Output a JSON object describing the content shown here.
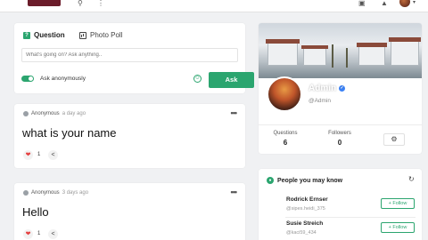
{
  "topbar": {
    "icons": [
      "logo-thumbnail",
      "search-icon",
      "menu-icon",
      "inbox-icon",
      "bell-icon",
      "avatar",
      "caret-down-icon"
    ]
  },
  "composer": {
    "tab_question": "Question",
    "tab_photo_poll": "Photo Poll",
    "input_placeholder": "What's going on? Ask anything..",
    "anonymous_label": "Ask anonymously",
    "ask_button": "Ask"
  },
  "posts": [
    {
      "author": "Anonymous",
      "time": "a day ago",
      "title": "what is your name",
      "likes": "1"
    },
    {
      "author": "Anonymous",
      "time": "3 days ago",
      "title": "Hello",
      "likes": "1"
    }
  ],
  "profile": {
    "name": "Admin",
    "handle": "@Admin",
    "questions_label": "Questions",
    "questions_value": "6",
    "followers_label": "Followers",
    "followers_value": "0"
  },
  "people": {
    "title": "People you may know",
    "items": [
      {
        "name": "Rodrick Ernser",
        "handle": "@sipes.heidi_375",
        "button": "Follow"
      },
      {
        "name": "Susie Streich",
        "handle": "@kaci59_434",
        "button": "Follow"
      }
    ]
  },
  "colors": {
    "accent": "#2ba56f",
    "like": "#e53e3e",
    "verified": "#3b82f6"
  }
}
